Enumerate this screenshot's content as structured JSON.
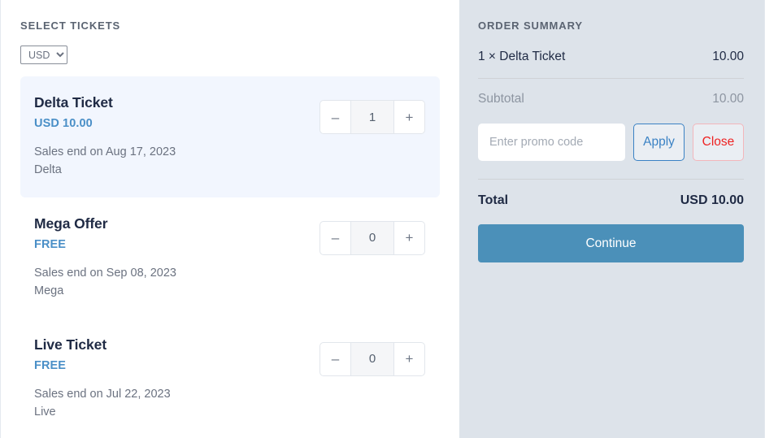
{
  "left": {
    "heading": "SELECT TICKETS",
    "currency": {
      "selected": "USD",
      "options": [
        "USD"
      ]
    },
    "stepper": {
      "decrement_label": "–",
      "increment_label": "+"
    },
    "tickets": [
      {
        "name": "Delta Ticket",
        "price": "USD 10.00",
        "sales_end": "Sales end on Aug 17, 2023",
        "category": "Delta",
        "quantity": "1",
        "selected": true
      },
      {
        "name": "Mega Offer",
        "price": "FREE",
        "sales_end": "Sales end on Sep 08, 2023",
        "category": "Mega",
        "quantity": "0",
        "selected": false
      },
      {
        "name": "Live Ticket",
        "price": "FREE",
        "sales_end": "Sales end on Jul 22, 2023",
        "category": "Live",
        "quantity": "0",
        "selected": false
      }
    ]
  },
  "summary": {
    "heading": "ORDER SUMMARY",
    "items": [
      {
        "label": "1 × Delta Ticket",
        "amount": "10.00"
      }
    ],
    "subtotal_label": "Subtotal",
    "subtotal_amount": "10.00",
    "promo": {
      "placeholder": "Enter promo code",
      "value": "",
      "apply_label": "Apply",
      "close_label": "Close"
    },
    "total_label": "Total",
    "total_amount": "USD 10.00",
    "continue_label": "Continue"
  },
  "colors": {
    "accent_blue": "#4a8fc7",
    "continue_button": "#4b90b9",
    "panel_background": "#dde3ea",
    "selected_card": "#f2f6fe",
    "apply_border": "#3b82c4",
    "close_text": "#ee2222",
    "heading_text": "#5b6472",
    "primary_text": "#1f2a44",
    "muted_text": "#6b7280"
  }
}
